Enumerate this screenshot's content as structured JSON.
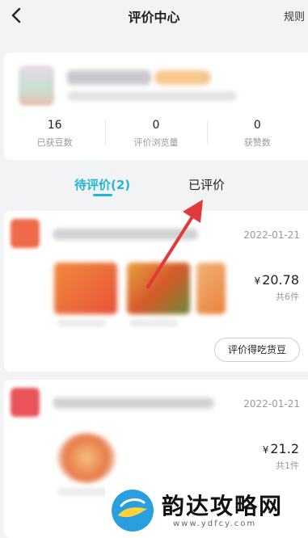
{
  "header": {
    "title": "评价中心",
    "rules_label": "规则",
    "back_icon": "chevron-left-icon"
  },
  "profile": {
    "stats": [
      {
        "value": "16",
        "label": "已获豆数"
      },
      {
        "value": "0",
        "label": "评价浏览量"
      },
      {
        "value": "0",
        "label": "获赞数"
      }
    ]
  },
  "tabs": [
    {
      "label": "待评价(2)",
      "active": true
    },
    {
      "label": "已评价",
      "active": false
    }
  ],
  "orders": [
    {
      "date": "2022-01-21",
      "price": "20.78",
      "currency": "¥",
      "count": "共6件",
      "review_button": "评价得吃货豆"
    },
    {
      "date": "2022-01-21",
      "price": "21.2",
      "currency": "¥",
      "count": "共1件"
    }
  ],
  "watermark": {
    "text": "韵达攻略网",
    "url": "www.ydfcy.com"
  },
  "colors": {
    "accent": "#21b5d8",
    "annotation_arrow": "#e23a3a",
    "background": "#f2f3f5"
  }
}
